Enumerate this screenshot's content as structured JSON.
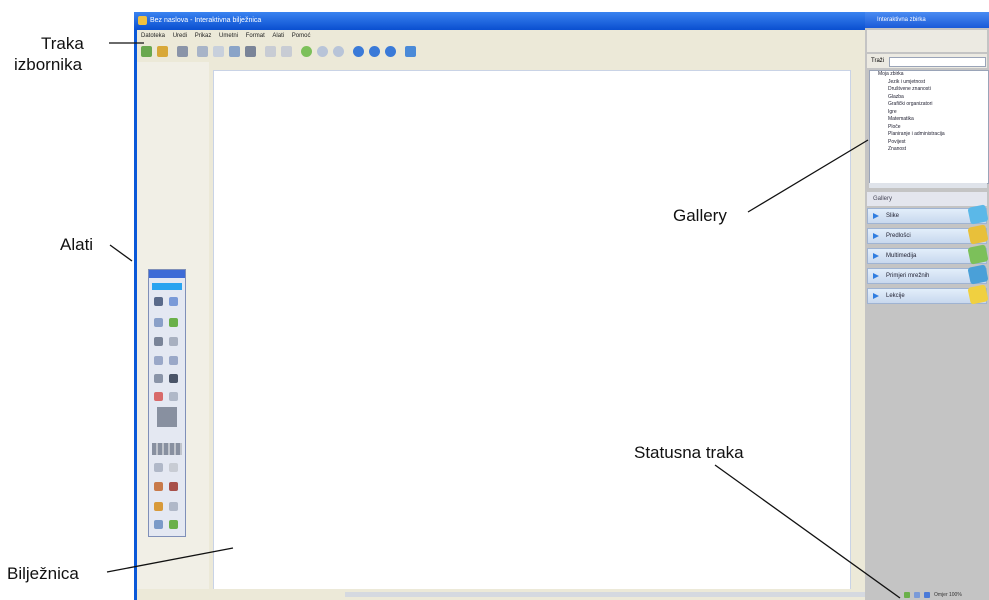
{
  "annotations": {
    "menu_bar_line1": "Traka",
    "menu_bar_line2": "izbornika",
    "tools": "Alati",
    "gallery": "Gallery",
    "status_bar": "Statusna traka",
    "notebook": "Bilježnica"
  },
  "window": {
    "title": "Bez naslova - Interaktivna bilježnica",
    "menu": [
      "Datoteka",
      "Uredi",
      "Prikaz",
      "Umetni",
      "Format",
      "Alati",
      "Pomoć"
    ]
  },
  "gallery_panel": {
    "title": "Interaktivna zbirka",
    "search_label": "Traži",
    "tree_root": "Moja zbirka",
    "tree_items": [
      "Jezik i umjetnost",
      "Društvene znanosti",
      "Glazba",
      "Grafički organizatori",
      "Igre",
      "Matematika",
      "Ploče",
      "Planiranje i administracija",
      "Povijest",
      "Znanost"
    ],
    "section_title": "Gallery",
    "categories": [
      {
        "label": "Slike",
        "color": "#5bb8e8"
      },
      {
        "label": "Predlošci",
        "color": "#e8c03a"
      },
      {
        "label": "Multimedija",
        "color": "#7cc05a"
      },
      {
        "label": "Primjeri mrežnih",
        "color": "#4aa0d8"
      },
      {
        "label": "Lekcije",
        "color": "#f0d040"
      }
    ]
  },
  "status": {
    "zoom_text": "Omjer 100%"
  },
  "colors": {
    "window_blue": "#0a58d8",
    "accent_blue": "#2f7de0"
  }
}
